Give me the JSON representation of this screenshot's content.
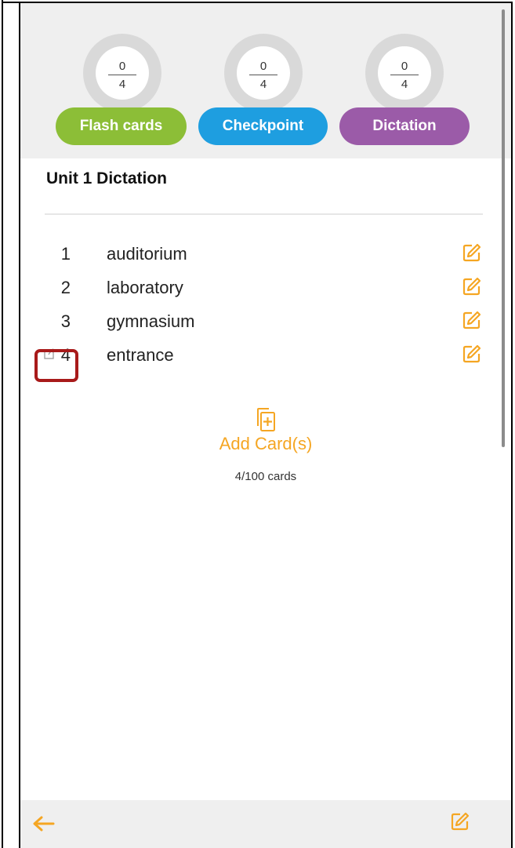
{
  "progress": [
    {
      "numerator": "0",
      "denominator": "4"
    },
    {
      "numerator": "0",
      "denominator": "4"
    },
    {
      "numerator": "0",
      "denominator": "4"
    }
  ],
  "modes": [
    {
      "label": "Flash cards",
      "color": "#8cbe37"
    },
    {
      "label": "Checkpoint",
      "color": "#1e9ee0"
    },
    {
      "label": "Dictation",
      "color": "#9b5ba8"
    }
  ],
  "title": "Unit 1 Dictation",
  "cards": [
    {
      "number": "1",
      "word": "auditorium"
    },
    {
      "number": "2",
      "word": "laboratory"
    },
    {
      "number": "3",
      "word": "gymnasium"
    },
    {
      "number": "4",
      "word": "entrance"
    }
  ],
  "add_card": {
    "label": "Add Card(s)",
    "count": "4/100 cards"
  },
  "colors": {
    "accent": "#f5a623",
    "highlight": "#a81a1a",
    "header_bg": "#efefef"
  },
  "icons": {
    "edit": "edit-icon",
    "share": "share-icon",
    "add": "add-card-icon",
    "back": "back-arrow-icon"
  }
}
